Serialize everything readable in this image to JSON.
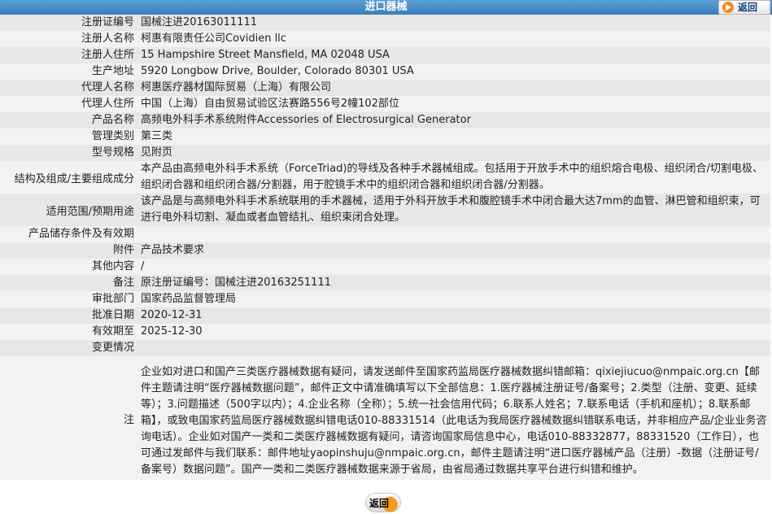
{
  "header": {
    "title": "进口器械",
    "back_label": "返回"
  },
  "rows": [
    {
      "label": "注册证编号",
      "value": "国械注进20163011111"
    },
    {
      "label": "注册人名称",
      "value": "柯惠有限责任公司Covidien llc"
    },
    {
      "label": "注册人住所",
      "value": "15 Hampshire Street Mansfield, MA 02048 USA"
    },
    {
      "label": "生产地址",
      "value": "5920 Longbow Drive, Boulder, Colorado 80301 USA"
    },
    {
      "label": "代理人名称",
      "value": "柯惠医疗器材国际贸易（上海）有限公司"
    },
    {
      "label": "代理人住所",
      "value": "中国（上海）自由贸易试验区法赛路556号2幢102部位"
    },
    {
      "label": "产品名称",
      "value": "高频电外科手术系统附件Accessories of Electrosurgical Generator"
    },
    {
      "label": "管理类别",
      "value": "第三类"
    },
    {
      "label": "型号规格",
      "value": "见附页"
    },
    {
      "label": "结构及组成/主要组成成分",
      "value": "本产品由高频电外科手术系统（ForceTriad)的导线及各种手术器械组成。包括用于开放手术中的组织熔合电极、组织闭合/切割电极、组织闭合器和组织闭合器/分割器，用于腔镜手术中的组织闭合器和组织闭合器/分割器。"
    },
    {
      "label": "适用范围/预期用途",
      "value": "该产品是与高频电外科手术系统联用的手术器械，适用于外科开放手术和腹腔镜手术中闭合最大达7mm的血管、淋巴管和组织束，可进行电外科切割、凝血或者血管结扎、组织束闭合处理。"
    },
    {
      "label": "产品储存条件及有效期",
      "value": ""
    },
    {
      "label": "附件",
      "value": "产品技术要求"
    },
    {
      "label": "其他内容",
      "value": "/"
    },
    {
      "label": "备注",
      "value": "原注册证编号：国械注进20163251111"
    },
    {
      "label": "审批部门",
      "value": "国家药品监督管理局"
    },
    {
      "label": "批准日期",
      "value": "2020-12-31"
    },
    {
      "label": "有效期至",
      "value": "2025-12-30"
    },
    {
      "label": "变更情况",
      "value": ""
    },
    {
      "label": "注",
      "value": "企业如对进口和国产三类医疗器械数据有疑问，请发送邮件至国家药监局医疗器械数据纠错邮箱：qixiejiucuo@nmpaic.org.cn【邮件主题请注明“医疗器械数据问题”，邮件正文中请准确填写以下全部信息：1.医疗器械注册证号/备案号；2.类型（注册、变更、延续等）；3.问题描述（500字以内）；4.企业名称（全称）；5.统一社会信用代码；6.联系人姓名；7.联系电话（手机和座机）；8.联系邮箱】，或致电国家药监局医疗器械数据纠错电话010-88331514（此电话为我局医疗器械数据纠错联系电话，并非相应产品/企业业务咨询电话）。企业如对国产一类和二类医疗器械数据有疑问，请咨询国家局信息中心，电话010-88332877，88331520（工作日），也可通过发邮件与我们联系：邮件地址yaopinshuju@nmpaic.org.cn，邮件主题请注明“进口医疗器械产品（注册）-数据（注册证号/备案号）数据问题”。国产一类和二类医疗器械数据来源于省局，由省局通过数据共享平台进行纠错和维护。"
    }
  ],
  "footer": {
    "back_label": "返回"
  },
  "colors": {
    "title_bar": "#3a7fbd",
    "row_odd": "#e7e7e7",
    "row_even": "#f2f2f2",
    "back_icon": "#f08a1a"
  }
}
